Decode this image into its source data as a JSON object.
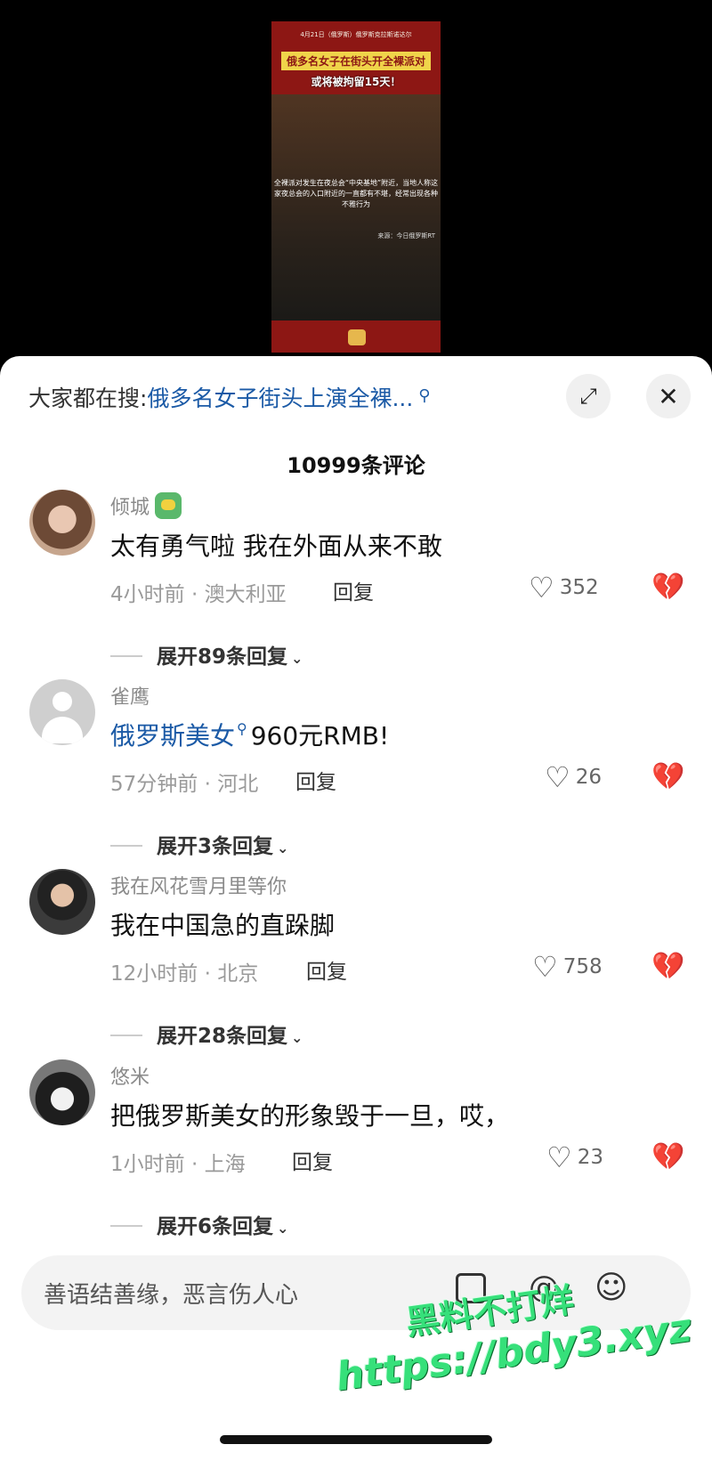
{
  "video": {
    "top_text": "4月21日（俄罗斯）俄罗斯克拉斯诺达尔",
    "caption_line1": "俄多名女子在街头开全裸派对",
    "caption_line2": "或将被拘留15天！",
    "bottom_text": "全裸派对发生在夜总会“中央基地”附近，当地人称这家夜总会的入口附近的一直都有不堪，经常出现各种不雅行为",
    "source": "来源：今日俄罗斯RT"
  },
  "search_bar": {
    "prefix": "大家都在搜:",
    "query": "俄多名女子街头上演全裸...",
    "search_glyph": "search-icon"
  },
  "header": {
    "comment_count": "10999条评论"
  },
  "comments": [
    {
      "username": "倾城",
      "text": "太有勇气啦 我在外面从来不敢",
      "meta": "4小时前 · 澳大利亚",
      "reply": "回复",
      "likes": "352",
      "expand": "展开89条回复"
    },
    {
      "username": "雀鹰",
      "text_link": "俄罗斯美女",
      "text_rest": "960元RMB!",
      "meta": "57分钟前 · 河北",
      "reply": "回复",
      "likes": "26",
      "expand": "展开3条回复"
    },
    {
      "username": "我在风花雪月里等你",
      "text": "我在中国急的直跺脚",
      "meta": "12小时前 · 北京",
      "reply": "回复",
      "likes": "758",
      "expand": "展开28条回复"
    },
    {
      "username": "悠米",
      "text": "把俄罗斯美女的形象毁于一旦，哎，",
      "meta": "1小时前 · 上海",
      "reply": "回复",
      "likes": "23",
      "expand": "展开6条回复"
    }
  ],
  "input": {
    "placeholder": "善语结善缘，恶言伤人心"
  },
  "watermark": {
    "line1": "黑料不打烊",
    "line2": "https://bdy3.xyz"
  }
}
